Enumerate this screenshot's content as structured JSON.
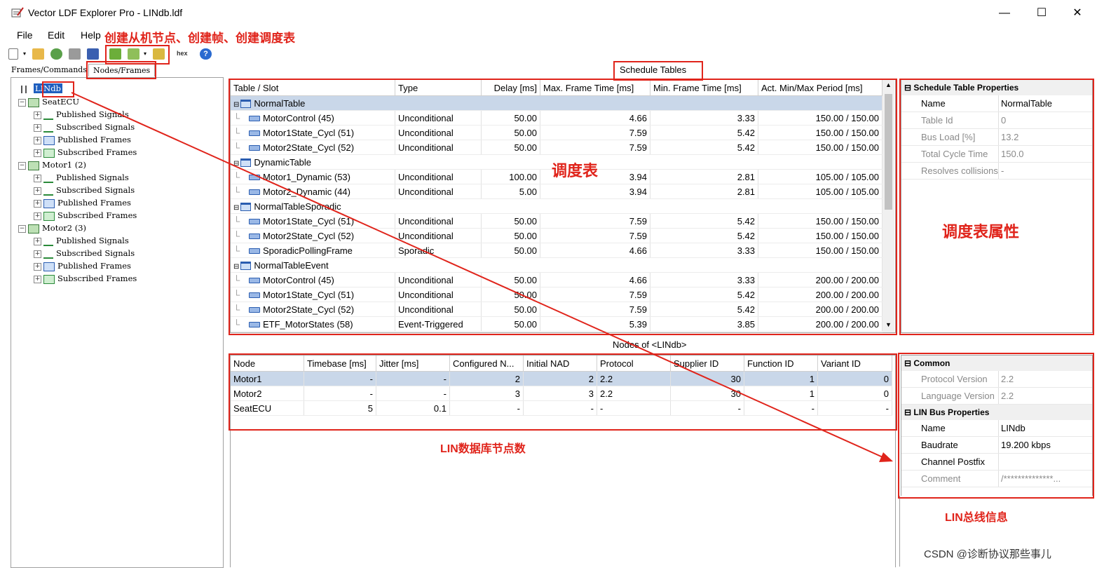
{
  "window": {
    "title": "Vector LDF Explorer Pro - LINdb.ldf",
    "minimize": "—",
    "maximize": "☐",
    "close": "✕"
  },
  "menu": {
    "items": [
      "File",
      "Edit",
      "Help"
    ],
    "annotation": "创建从机节点、创建帧、创建调度表"
  },
  "toolbar": {
    "hex_label": "hex"
  },
  "left_tabs": [
    "Frames/Commands",
    "Nodes/Frames"
  ],
  "tree": {
    "root": "LINdb",
    "nodes": [
      {
        "label": "SeatECU",
        "children": [
          "Published Signals",
          "Subscribed Signals",
          "Published Frames",
          "Subscribed Frames"
        ]
      },
      {
        "label": "Motor1 (2)",
        "children": [
          "Published Signals",
          "Subscribed Signals",
          "Published Frames",
          "Subscribed Frames"
        ]
      },
      {
        "label": "Motor2 (3)",
        "children": [
          "Published Signals",
          "Subscribed Signals",
          "Published Frames",
          "Subscribed Frames"
        ]
      }
    ]
  },
  "schedule": {
    "caption": "Schedule Tables",
    "annotation": "调度表",
    "columns": [
      "Table / Slot",
      "Type",
      "Delay [ms]",
      "Max. Frame Time [ms]",
      "Min. Frame Time [ms]",
      "Act. Min/Max Period [ms]"
    ],
    "groups": [
      {
        "name": "NormalTable",
        "rows": [
          [
            "MotorControl (45)",
            "Unconditional",
            "50.00",
            "4.66",
            "3.33",
            "150.00 / 150.00"
          ],
          [
            "Motor1State_Cycl (51)",
            "Unconditional",
            "50.00",
            "7.59",
            "5.42",
            "150.00 / 150.00"
          ],
          [
            "Motor2State_Cycl (52)",
            "Unconditional",
            "50.00",
            "7.59",
            "5.42",
            "150.00 / 150.00"
          ]
        ]
      },
      {
        "name": "DynamicTable",
        "rows": [
          [
            "Motor1_Dynamic (53)",
            "Unconditional",
            "100.00",
            "3.94",
            "2.81",
            "105.00 / 105.00"
          ],
          [
            "Motor2_Dynamic (44)",
            "Unconditional",
            "5.00",
            "3.94",
            "2.81",
            "105.00 / 105.00"
          ]
        ]
      },
      {
        "name": "NormalTableSporadic",
        "rows": [
          [
            "Motor1State_Cycl (51)",
            "Unconditional",
            "50.00",
            "7.59",
            "5.42",
            "150.00 / 150.00"
          ],
          [
            "Motor2State_Cycl (52)",
            "Unconditional",
            "50.00",
            "7.59",
            "5.42",
            "150.00 / 150.00"
          ],
          [
            "SporadicPollingFrame",
            "Sporadic",
            "50.00",
            "4.66",
            "3.33",
            "150.00 / 150.00"
          ]
        ]
      },
      {
        "name": "NormalTableEvent",
        "rows": [
          [
            "MotorControl (45)",
            "Unconditional",
            "50.00",
            "4.66",
            "3.33",
            "200.00 / 200.00"
          ],
          [
            "Motor1State_Cycl (51)",
            "Unconditional",
            "50.00",
            "7.59",
            "5.42",
            "200.00 / 200.00"
          ],
          [
            "Motor2State_Cycl (52)",
            "Unconditional",
            "50.00",
            "7.59",
            "5.42",
            "200.00 / 200.00"
          ],
          [
            "ETF_MotorStates (58)",
            "Event-Triggered",
            "50.00",
            "5.39",
            "3.85",
            "200.00 / 200.00"
          ]
        ]
      }
    ]
  },
  "schedule_props": {
    "header": "Schedule Table Properties",
    "annotation": "调度表属性",
    "rows": [
      {
        "key": "Name",
        "value": "NormalTable"
      },
      {
        "key": "Table Id",
        "value": "0"
      },
      {
        "key": "Bus Load [%]",
        "value": "13.2"
      },
      {
        "key": "Total Cycle Time",
        "value": "150.0"
      },
      {
        "key": "Resolves collisions",
        "value": "-"
      }
    ]
  },
  "nodes": {
    "caption": "Nodes of <LINdb>",
    "annotation": "LIN数据库节点数",
    "columns": [
      "Node",
      "Timebase [ms]",
      "Jitter [ms]",
      "Configured N...",
      "Initial NAD",
      "Protocol",
      "Supplier ID",
      "Function ID",
      "Variant ID"
    ],
    "rows": [
      [
        "Motor1",
        "-",
        "-",
        "2",
        "2",
        "2.2",
        "30",
        "1",
        "0"
      ],
      [
        "Motor2",
        "-",
        "-",
        "3",
        "3",
        "2.2",
        "30",
        "1",
        "0"
      ],
      [
        "SeatECU",
        "5",
        "0.1",
        "-",
        "-",
        "-",
        "-",
        "-",
        "-"
      ]
    ]
  },
  "common_props": {
    "header": "Common",
    "rows": [
      {
        "key": "Protocol Version",
        "value": "2.2"
      },
      {
        "key": "Language Version",
        "value": "2.2"
      }
    ]
  },
  "bus_props": {
    "header": "LIN Bus Properties",
    "annotation": "LIN总线信息",
    "rows": [
      {
        "key": "Name",
        "value": "LINdb"
      },
      {
        "key": "Baudrate",
        "value": "19.200 kbps"
      },
      {
        "key": "Channel Postfix",
        "value": ""
      },
      {
        "key": "Comment",
        "value": "/**************..."
      }
    ]
  },
  "watermark": "CSDN @诊断协议那些事儿",
  "colors": {
    "annotation": "#e0241b",
    "selection": "#c9d7e9",
    "icon_blue": "#2a5db0"
  }
}
